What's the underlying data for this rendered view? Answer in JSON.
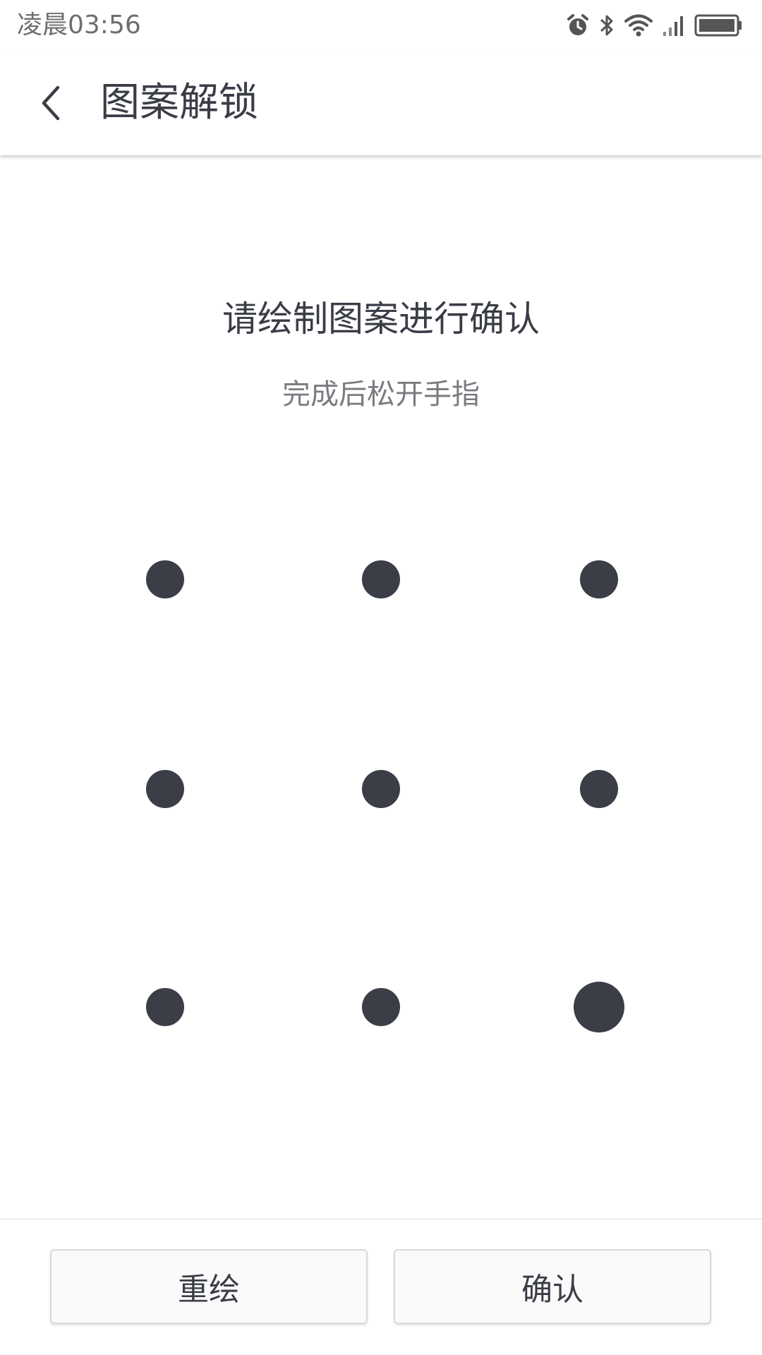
{
  "status_bar": {
    "time": "凌晨03:56",
    "icons": [
      "alarm-icon",
      "bluetooth-icon",
      "wifi-icon",
      "signal-icon",
      "battery-icon"
    ]
  },
  "app_bar": {
    "back_icon": "chevron-left-icon",
    "title": "图案解锁"
  },
  "prompt": {
    "title": "请绘制图案进行确认",
    "subtitle": "完成后松开手指"
  },
  "pattern": {
    "rows": 3,
    "cols": 3,
    "dot_color": "#3b3d47",
    "highlighted_dot_index": 8
  },
  "buttons": {
    "redraw_label": "重绘",
    "confirm_label": "确认"
  },
  "colors": {
    "text_primary": "#3a3d46",
    "text_secondary": "#7a7b80",
    "background": "#ffffff"
  }
}
